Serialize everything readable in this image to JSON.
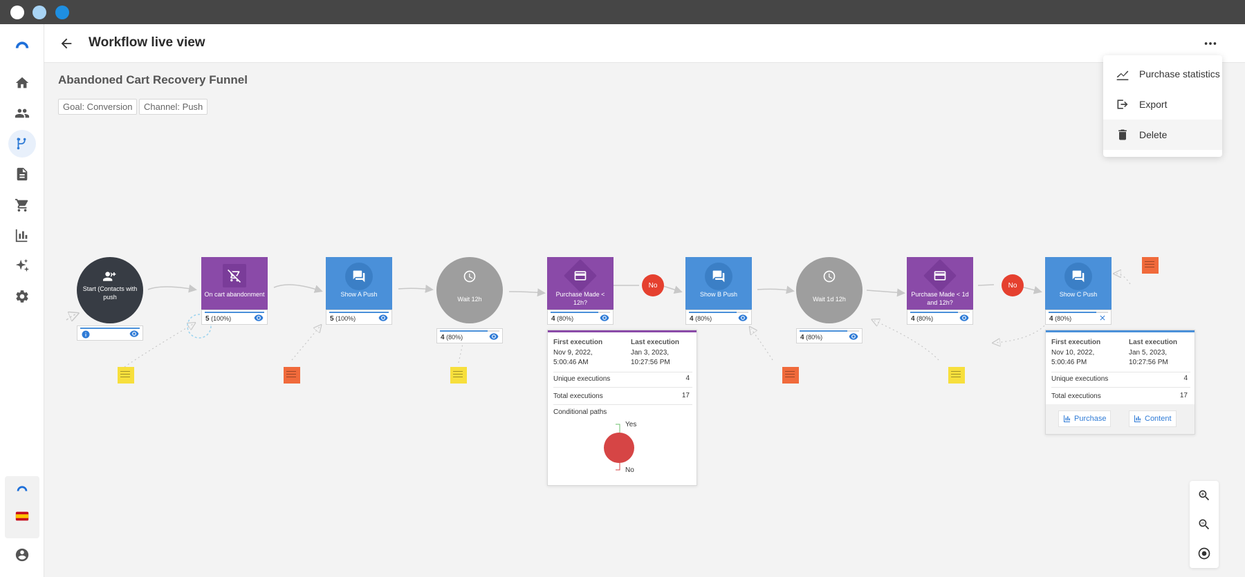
{
  "window": {
    "traffic_lights": [
      "#ffffff",
      "#a8d4f5",
      "#1e8fe1"
    ]
  },
  "header": {
    "title": "Workflow live view",
    "back_icon": "arrow-left-icon",
    "more_icon": "more-horizontal-icon"
  },
  "sidebar": {
    "items": [
      {
        "name": "home",
        "icon": "home-icon",
        "active": false
      },
      {
        "name": "contacts",
        "icon": "users-icon",
        "active": false
      },
      {
        "name": "workflows",
        "icon": "workflow-icon",
        "active": true
      },
      {
        "name": "documents",
        "icon": "document-icon",
        "active": false
      },
      {
        "name": "commerce",
        "icon": "cart-icon",
        "active": false
      },
      {
        "name": "analytics",
        "icon": "bar-chart-icon",
        "active": false
      },
      {
        "name": "ai",
        "icon": "sparkles-icon",
        "active": false
      },
      {
        "name": "settings",
        "icon": "gear-icon",
        "active": false
      }
    ],
    "bottom": [
      "brand-logo-icon",
      "spain-flag-icon",
      "account-icon"
    ]
  },
  "workflow": {
    "name": "Abandoned Cart Recovery Funnel",
    "tags": [
      "Goal: Conversion",
      "Channel: Push"
    ]
  },
  "menu": {
    "items": [
      {
        "label": "Purchase statistics",
        "icon": "line-chart-icon"
      },
      {
        "label": "Export",
        "icon": "export-icon"
      },
      {
        "label": "Delete",
        "icon": "trash-icon"
      }
    ]
  },
  "nodes": [
    {
      "label": "Start (Contacts with push",
      "type": "start",
      "icon": "add-group-icon",
      "count": "",
      "pct": "",
      "info_icon": "info-icon"
    },
    {
      "label": "On cart abandonment",
      "type": "trigger",
      "icon": "cart-off-icon",
      "count": "5",
      "pct": "(100%)"
    },
    {
      "label": "Show A Push",
      "type": "push",
      "icon": "chat-icon",
      "count": "5",
      "pct": "(100%)"
    },
    {
      "label": "Wait 12h",
      "type": "wait",
      "icon": "clock-icon",
      "count": "4",
      "pct": "(80%)"
    },
    {
      "label": "Purchase Made < 12h?",
      "type": "condition",
      "icon": "credit-card-icon",
      "count": "4",
      "pct": "(80%)"
    },
    {
      "label": "Show B Push",
      "type": "push",
      "icon": "chat-icon",
      "count": "4",
      "pct": "(80%)"
    },
    {
      "label": "Wait 1d 12h",
      "type": "wait",
      "icon": "clock-icon",
      "count": "4",
      "pct": "(80%)"
    },
    {
      "label": "Purchase Made < 1d and 12h?",
      "type": "condition",
      "icon": "credit-card-icon",
      "count": "4",
      "pct": "(80%)"
    },
    {
      "label": "Show C Push",
      "type": "push",
      "icon": "chat-icon",
      "count": "4",
      "pct": "(80%)"
    }
  ],
  "branch_badges": [
    "No",
    "No"
  ],
  "popover_condition": {
    "first_label": "First execution",
    "first_value_1": "Nov 9, 2022,",
    "first_value_2": "5:00:46 AM",
    "last_label": "Last execution",
    "last_value_1": "Jan 3, 2023,",
    "last_value_2": "10:27:56 PM",
    "unique_label": "Unique executions",
    "unique_value": "4",
    "total_label": "Total executions",
    "total_value": "17",
    "paths_label": "Conditional paths",
    "path_yes": "Yes",
    "path_no": "No",
    "path_color": "#d64545"
  },
  "popover_push": {
    "first_label": "First execution",
    "first_value_1": "Nov 10, 2022,",
    "first_value_2": "5:00:46 PM",
    "last_label": "Last execution",
    "last_value_1": "Jan 5, 2023,",
    "last_value_2": "10:27:56 PM",
    "unique_label": "Unique executions",
    "unique_value": "4",
    "total_label": "Total executions",
    "total_value": "17",
    "btn_purchase": "Purchase",
    "btn_content": "Content"
  },
  "zoom": [
    "zoom-in-icon",
    "zoom-out-icon",
    "recenter-icon"
  ],
  "colors": {
    "purple_node": "#8a4aa8",
    "blue_node": "#4a90d9",
    "wait_node": "#9e9e9e",
    "start_node": "#373c44",
    "no_badge": "#e5402f",
    "accent": "#2f7bd6"
  }
}
